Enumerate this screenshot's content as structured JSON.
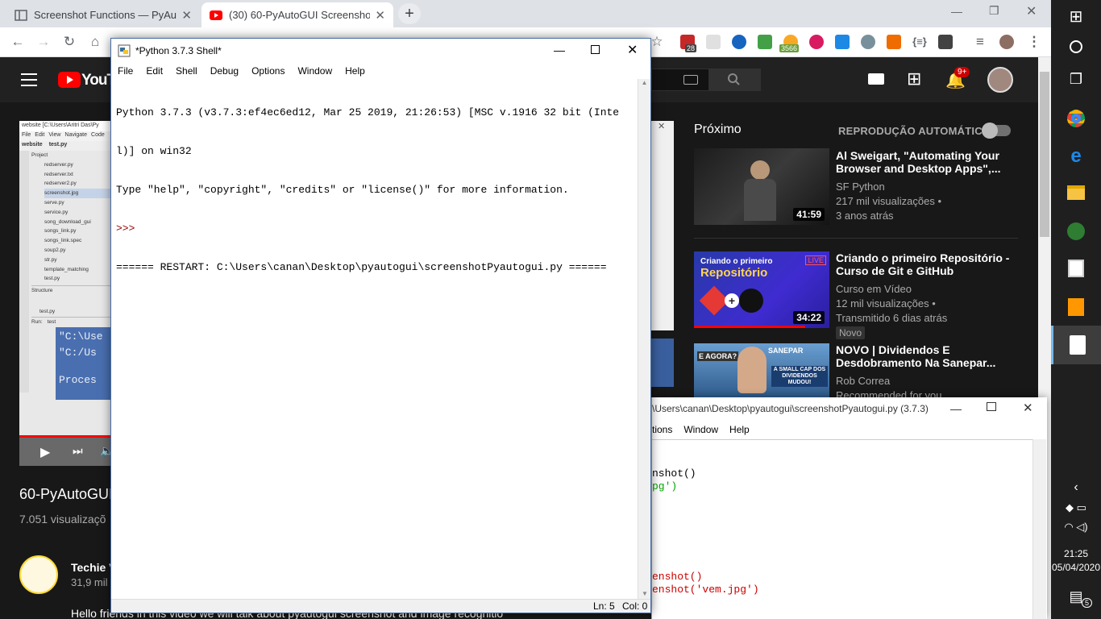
{
  "browser": {
    "tabs": [
      {
        "title": "Screenshot Functions — PyAutoG",
        "icon": "doc-icon"
      },
      {
        "title": "(30) 60-PyAutoGUI Screenshot &",
        "icon": "youtube-icon"
      }
    ],
    "new_tab_label": "+",
    "badges": {
      "ext1": "28",
      "ext2": "3566"
    }
  },
  "youtube": {
    "logo_text": "YouTu",
    "notification_count": "9+",
    "next_label": "Próximo",
    "autoplay_label": "REPRODUÇÃO AUTOMÁTICA",
    "video_title": "60-PyAutoGUI",
    "views": "7.051 visualizaçõ",
    "channel_name": "Techie V",
    "subscribers": "31,9 mil",
    "description": "Hello friends in this video we will talk about pyautogui screenshot and image recognitio",
    "recommendations": [
      {
        "title": "Al Sweigart, \"Automating Your Browser and Desktop Apps\",...",
        "channel": "SF Python",
        "meta1": "217 mil visualizações •",
        "meta2": "3 anos atrás",
        "duration": "41:59",
        "badge": ""
      },
      {
        "title": "Criando o primeiro Repositório - Curso de Git e GitHub",
        "channel": "Curso em Vídeo",
        "meta1": "12 mil visualizações •",
        "meta2": "Transmitido 6 dias atrás",
        "duration": "34:22",
        "badge": "Novo",
        "thumb_text1": "Criando o primeiro",
        "thumb_text2": "Repositório",
        "thumb_live": "LIVE"
      },
      {
        "title": "NOVO | Dividendos E Desdobramento Na Sanepar...",
        "channel": "Rob Correa",
        "meta1": "Recommended for you",
        "meta2": "",
        "duration": "",
        "badge": "",
        "thumb_text1": "E AGORA?",
        "thumb_text2": "SANEPAR",
        "thumb_text3": "A SMALL CAP DOS DIVIDENDOS MUDOU!"
      }
    ],
    "ide_preview": {
      "title": "website [C:\\Users\\Aritri Das\\Py",
      "menu": [
        "File",
        "Edit",
        "View",
        "Navigate",
        "Code"
      ],
      "breadcrumb": [
        "website",
        "test.py"
      ],
      "project_label": "Project",
      "files": [
        "redserver.py",
        "redserver.txt",
        "redserver2.py",
        "screenshot.jpg",
        "serve.py",
        "service.py",
        "song_download_gui",
        "songs_link.py",
        "songs_link.spec",
        "soup2.py",
        "str.py",
        "template_matching",
        "test.py"
      ],
      "structure_label": "Structure",
      "struct_file": "test.py",
      "run_label": "Run:",
      "run_tab": "test",
      "console_lines": [
        "\"C:\\Use",
        "\"C:/Us",
        "Proces"
      ]
    }
  },
  "shell": {
    "title": "*Python 3.7.3 Shell*",
    "menu": [
      "File",
      "Edit",
      "Shell",
      "Debug",
      "Options",
      "Window",
      "Help"
    ],
    "line1": "Python 3.7.3 (v3.7.3:ef4ec6ed12, Mar 25 2019, 21:26:53) [MSC v.1916 32 bit (Inte",
    "line2": "l)] on win32",
    "line3": "Type \"help\", \"copyright\", \"credits\" or \"license()\" for more information.",
    "prompt": ">>> ",
    "restart": "====== RESTART: C:\\Users\\canan\\Desktop\\pyautogui\\screenshotPyautogui.py ======",
    "status_ln": "Ln: 5",
    "status_col": "Col: 0"
  },
  "editor": {
    "title": "\\Users\\canan\\Desktop\\pyautogui\\screenshotPyautogui.py (3.7.3)",
    "menu": [
      "tions",
      "Window",
      "Help"
    ],
    "code": [
      {
        "text": "nshot()",
        "color": "#000000"
      },
      {
        "text": "pg')",
        "color": "#00aa00"
      },
      {
        "text": "enshot()",
        "color": "#cc0000"
      },
      {
        "text": "enshot('vem.jpg')",
        "color": "#cc0000"
      }
    ]
  },
  "taskbar": {
    "time": "21:25",
    "date": "05/04/2020",
    "notifications": "5"
  }
}
